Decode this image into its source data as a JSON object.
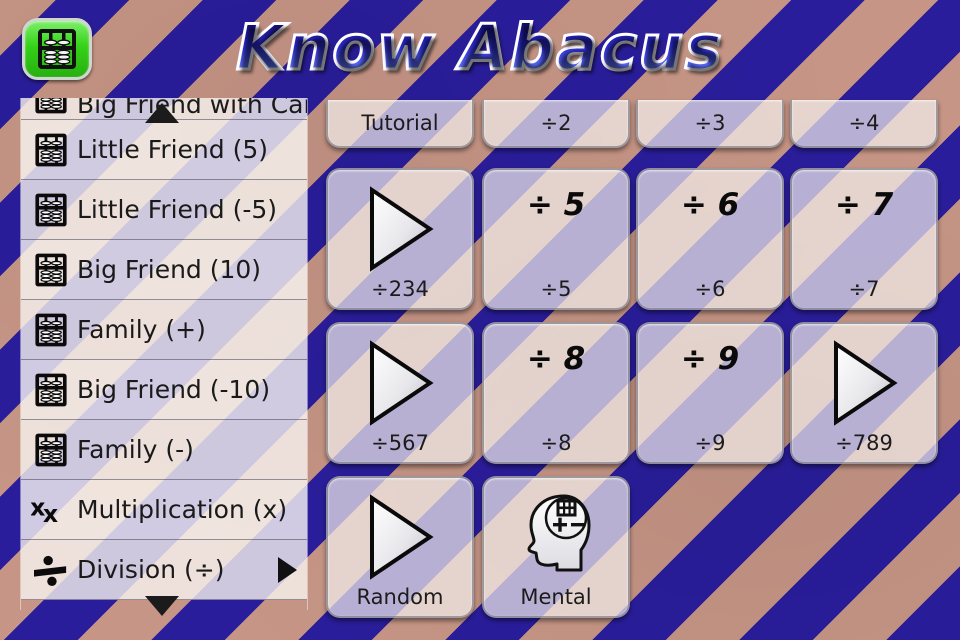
{
  "header": {
    "title": "Know Abacus",
    "app_icon_name": "abacus-app-icon"
  },
  "sidebar": {
    "scroll_up_icon": "scroll-up-arrow",
    "scroll_down_icon": "scroll-down-arrow",
    "items": [
      {
        "label": "Big Friend with Carry",
        "icon": "abacus-icon",
        "clipped": true,
        "selected": false
      },
      {
        "label": "Little Friend (5)",
        "icon": "abacus-icon",
        "clipped": false,
        "selected": false
      },
      {
        "label": "Little Friend (-5)",
        "icon": "abacus-icon",
        "clipped": false,
        "selected": false
      },
      {
        "label": "Big Friend (10)",
        "icon": "abacus-icon",
        "clipped": false,
        "selected": false
      },
      {
        "label": "Family (+)",
        "icon": "abacus-icon",
        "clipped": false,
        "selected": false
      },
      {
        "label": "Big Friend (-10)",
        "icon": "abacus-icon",
        "clipped": false,
        "selected": false
      },
      {
        "label": "Family (-)",
        "icon": "abacus-icon",
        "clipped": false,
        "selected": false
      },
      {
        "label": "Multiplication (x)",
        "icon": "multiplication-icon",
        "clipped": false,
        "selected": false
      },
      {
        "label": "Division (÷)",
        "icon": "division-icon",
        "clipped": false,
        "selected": true
      }
    ]
  },
  "grid": {
    "tiles": [
      {
        "big": "",
        "caption": "Tutorial",
        "icon": "none",
        "row": 0,
        "col": 0
      },
      {
        "big": "",
        "caption": "÷2",
        "icon": "none",
        "row": 0,
        "col": 1
      },
      {
        "big": "",
        "caption": "÷3",
        "icon": "none",
        "row": 0,
        "col": 2
      },
      {
        "big": "",
        "caption": "÷4",
        "icon": "none",
        "row": 0,
        "col": 3
      },
      {
        "big": "",
        "caption": "÷234",
        "icon": "play-triangle-icon",
        "row": 1,
        "col": 0
      },
      {
        "big": "÷ 5",
        "caption": "÷5",
        "icon": "none",
        "row": 1,
        "col": 1
      },
      {
        "big": "÷ 6",
        "caption": "÷6",
        "icon": "none",
        "row": 1,
        "col": 2
      },
      {
        "big": "÷ 7",
        "caption": "÷7",
        "icon": "none",
        "row": 1,
        "col": 3
      },
      {
        "big": "",
        "caption": "÷567",
        "icon": "play-triangle-icon",
        "row": 2,
        "col": 0
      },
      {
        "big": "÷ 8",
        "caption": "÷8",
        "icon": "none",
        "row": 2,
        "col": 1
      },
      {
        "big": "÷ 9",
        "caption": "÷9",
        "icon": "none",
        "row": 2,
        "col": 2
      },
      {
        "big": "",
        "caption": "÷789",
        "icon": "play-triangle-icon",
        "row": 2,
        "col": 3
      },
      {
        "big": "",
        "caption": "Random",
        "icon": "play-triangle-icon",
        "row": 3,
        "col": 0
      },
      {
        "big": "",
        "caption": "Mental",
        "icon": "mental-head-icon",
        "row": 3,
        "col": 1
      }
    ]
  },
  "colors": {
    "stripe_blue": "#2a1d9c",
    "stripe_tan": "#c69585",
    "tile_face": "#f3f0ec",
    "menu_face": "#f7f4f0",
    "icon_green": "#35d117",
    "title_blue": "#2f2fd8"
  }
}
